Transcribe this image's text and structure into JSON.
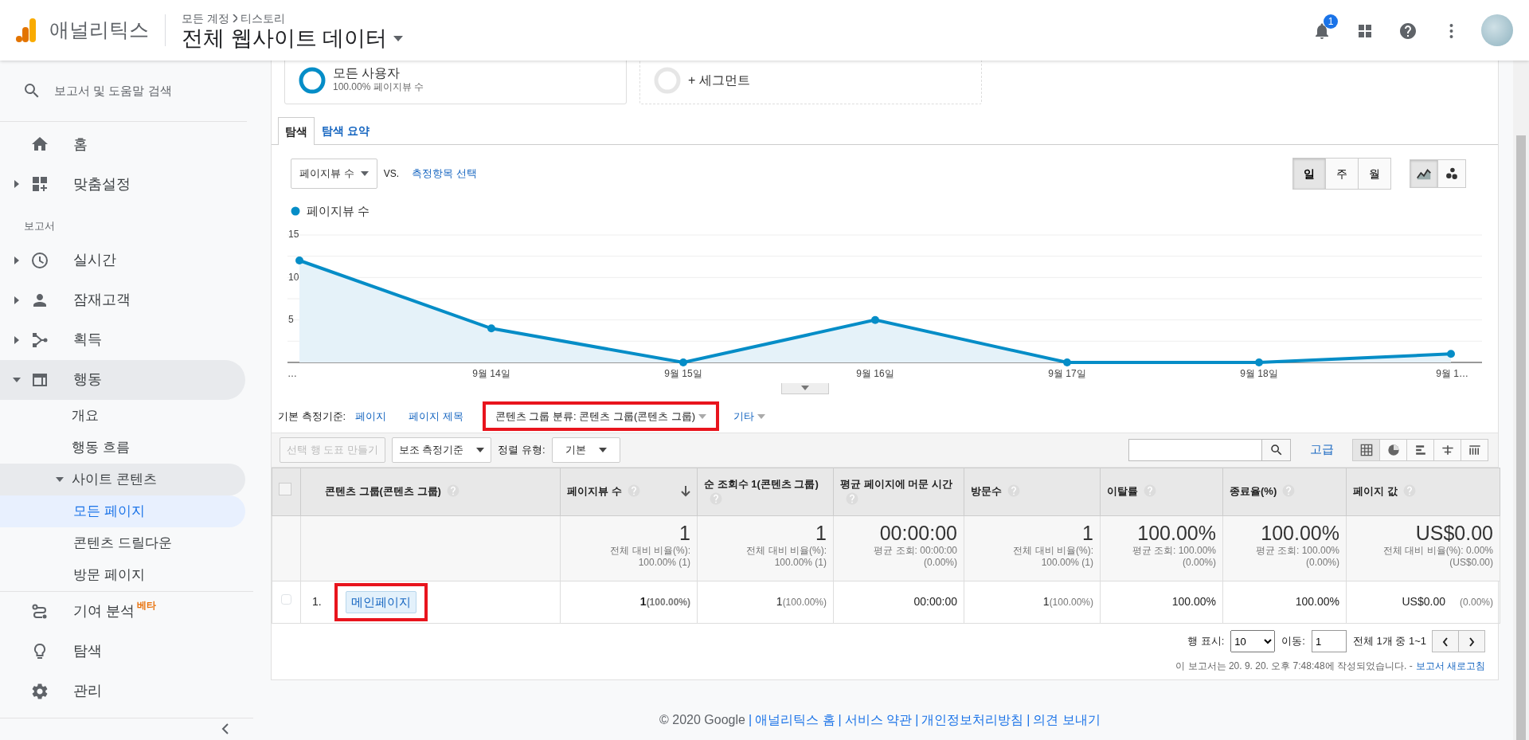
{
  "header": {
    "product": "애널리틱스",
    "breadcrumb": [
      "모든 계정",
      "티스토리"
    ],
    "view": "전체 웹사이트 데이터",
    "notifications": "1"
  },
  "sidebar": {
    "search": "보고서 및 도움말 검색",
    "items": [
      {
        "kind": "link",
        "label": "홈",
        "selected": false
      },
      {
        "kind": "group",
        "label": "맞춤설정",
        "expanded": false,
        "selected": false
      },
      {
        "kind": "heading",
        "label": "보고서"
      },
      {
        "kind": "group",
        "label": "실시간",
        "expanded": false,
        "selected": false
      },
      {
        "kind": "group",
        "label": "잠재고객",
        "expanded": false,
        "selected": false
      },
      {
        "kind": "group",
        "label": "획득",
        "expanded": false,
        "selected": false
      },
      {
        "kind": "group",
        "label": "행동",
        "expanded": true,
        "selected": false,
        "children": [
          {
            "kind": "link",
            "label": "개요",
            "selected": false
          },
          {
            "kind": "link",
            "label": "행동 흐름",
            "selected": false
          },
          {
            "kind": "group",
            "label": "사이트 콘텐츠",
            "expanded": true,
            "selected": false,
            "children": [
              {
                "kind": "link",
                "label": "모든 페이지",
                "selected": true
              },
              {
                "kind": "link",
                "label": "콘텐츠 드릴다운",
                "selected": false
              },
              {
                "kind": "link",
                "label": "방문 페이지",
                "selected": false
              }
            ]
          }
        ]
      },
      {
        "kind": "link",
        "label": "기여 분석",
        "badge": "베타",
        "selected": false
      },
      {
        "kind": "link",
        "label": "탐색",
        "selected": false
      },
      {
        "kind": "link",
        "label": "관리",
        "selected": false
      }
    ]
  },
  "segments": [
    {
      "kind": "active",
      "name": "모든 사용자",
      "detail": "100.00% 페이지뷰 수"
    },
    {
      "kind": "add",
      "name": "+ 세그먼트"
    }
  ],
  "tabs": [
    {
      "label": "탐색",
      "selected": true
    },
    {
      "label": "탐색 요약",
      "selected": false
    }
  ],
  "metric": {
    "primary": "페이지뷰 수",
    "vs": "VS.",
    "compare": "측정항목 선택"
  },
  "periods": [
    {
      "label": "일",
      "selected": true
    },
    {
      "label": "주",
      "selected": false
    },
    {
      "label": "월",
      "selected": false
    }
  ],
  "chart_views": [
    {
      "kind": "line",
      "selected": true
    },
    {
      "kind": "motion",
      "selected": false
    }
  ],
  "chart_data": {
    "type": "area",
    "categories": [
      "…",
      "9월 14일",
      "9월 15일",
      "9월 16일",
      "9월 17일",
      "9월 18일",
      "9월 1…"
    ],
    "ylim": [
      0,
      15
    ],
    "yticks": [
      5,
      10,
      15
    ],
    "series": [
      {
        "name": "페이지뷰 수",
        "color": "#058dc7",
        "values": [
          12,
          4,
          0,
          5,
          0,
          0,
          1
        ]
      }
    ]
  },
  "dimensions": {
    "label": "기본 측정기준:",
    "options": [
      {
        "label": "페이지",
        "selected": false,
        "menu": false,
        "highlighted": false
      },
      {
        "label": "페이지 제목",
        "selected": false,
        "menu": false,
        "highlighted": false
      },
      {
        "label": "콘텐츠 그룹 분류: 콘텐츠 그룹(콘텐츠 그룹)",
        "selected": true,
        "menu": true,
        "highlighted": true
      },
      {
        "label": "기타",
        "selected": false,
        "menu": true,
        "highlighted": false
      }
    ]
  },
  "toolbar": {
    "plot_rows": "선택 행 도표 만들기",
    "plot_rows_disabled": true,
    "secondary": "보조 측정기준",
    "sort_label": "정렬 유형:",
    "sort": "기본",
    "advanced": "고급",
    "views": [
      {
        "kind": "table",
        "selected": true
      },
      {
        "kind": "pie",
        "selected": false
      },
      {
        "kind": "bars",
        "selected": false
      },
      {
        "kind": "compare",
        "selected": false
      },
      {
        "kind": "pivot",
        "selected": false
      }
    ]
  },
  "table": {
    "select_all_checked": false,
    "columns": [
      {
        "label": "콘텐츠 그룹(콘텐츠 그룹)",
        "sorted": false
      },
      {
        "label": "페이지뷰 수",
        "sorted": true
      },
      {
        "label": "순 조회수 1(콘텐츠 그룹)",
        "sorted": false
      },
      {
        "label": "평균 페이지에 머문 시간",
        "sorted": false
      },
      {
        "label": "방문수",
        "sorted": false
      },
      {
        "label": "이탈률",
        "sorted": false
      },
      {
        "label": "종료율(%)",
        "sorted": false
      },
      {
        "label": "페이지 값",
        "sorted": false
      }
    ],
    "totals": [
      {
        "kind": "empty"
      },
      {
        "kind": "total",
        "value": "1",
        "detail": [
          "전체 대비 비율(%):",
          "100.00% (1)"
        ]
      },
      {
        "kind": "total",
        "value": "1",
        "detail": [
          "전체 대비 비율(%):",
          "100.00% (1)"
        ]
      },
      {
        "kind": "total",
        "value": "00:00:00",
        "detail": [
          "평균 조회: 00:00:00",
          "(0.00%)"
        ]
      },
      {
        "kind": "total",
        "value": "1",
        "detail": [
          "전체 대비 비율(%):",
          "100.00% (1)"
        ]
      },
      {
        "kind": "total",
        "value": "100.00%",
        "detail": [
          "평균 조회: 100.00%",
          "(0.00%)"
        ]
      },
      {
        "kind": "total",
        "value": "100.00%",
        "detail": [
          "평균 조회: 100.00%",
          "(0.00%)"
        ]
      },
      {
        "kind": "total",
        "value": "US$0.00",
        "detail": [
          "전체 대비 비율(%): 0.00%",
          "(US$0.00)"
        ]
      }
    ],
    "rows": [
      {
        "checked": false,
        "cells": [
          {
            "kind": "label",
            "index": "1.",
            "value": "메인페이지",
            "highlighted": true
          },
          {
            "kind": "metric",
            "value": "1",
            "share": "(100.00%)"
          },
          {
            "kind": "metric",
            "value": "1",
            "share": "(100.00%)"
          },
          {
            "kind": "metric",
            "value": "00:00:00"
          },
          {
            "kind": "metric",
            "value": "1",
            "share": "(100.00%)"
          },
          {
            "kind": "metric",
            "value": "100.00%"
          },
          {
            "kind": "metric",
            "value": "100.00%"
          },
          {
            "kind": "metric",
            "value": "US$0.00",
            "share": "(0.00%)"
          }
        ]
      }
    ]
  },
  "pagination": {
    "rows_label": "행 표시:",
    "rows": "10",
    "goto_label": "이동:",
    "goto": "1",
    "range": "전체 1개 중 1~1"
  },
  "report_note": {
    "text": "이 보고서는 20. 9. 20. 오후 7:48:48에 작성되었습니다. -",
    "link": "보고서 새로고침"
  },
  "footer": [
    {
      "kind": "text",
      "text": "© 2020 Google"
    },
    {
      "kind": "sep",
      "text": "|"
    },
    {
      "kind": "link",
      "text": "애널리틱스 홈"
    },
    {
      "kind": "sep",
      "text": "|"
    },
    {
      "kind": "link",
      "text": "서비스 약관"
    },
    {
      "kind": "sep",
      "text": "|"
    },
    {
      "kind": "link",
      "text": "개인정보처리방침"
    },
    {
      "kind": "sep",
      "text": "|"
    },
    {
      "kind": "link",
      "text": "의견 보내기"
    }
  ]
}
